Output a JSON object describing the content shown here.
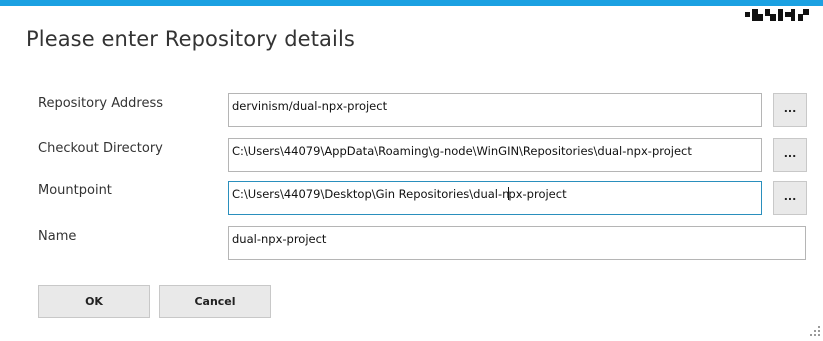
{
  "dialog": {
    "title": "Please enter Repository details"
  },
  "colors": {
    "accent": "#1ba1e2",
    "focus_border": "#2a8fbd",
    "button_bg": "#e9e9e9"
  },
  "fields": {
    "repository_address": {
      "label": "Repository Address",
      "value": "dervinism/dual-npx-project",
      "browse_label": "..."
    },
    "checkout_directory": {
      "label": "Checkout Directory",
      "value": "C:\\Users\\44079\\AppData\\Roaming\\g-node\\WinGIN\\Repositories\\dual-npx-project",
      "browse_label": "..."
    },
    "mountpoint": {
      "label": "Mountpoint",
      "value_before_caret": "C:\\Users\\44079\\Desktop\\Gin Repositories\\dual-n",
      "value_after_caret": "px-project",
      "browse_label": "..."
    },
    "name": {
      "label": "Name",
      "value": "dual-npx-project"
    }
  },
  "buttons": {
    "ok_label": "OK",
    "cancel_label": "Cancel"
  },
  "icons": {
    "window_controls": "window-controls-icon",
    "resize_grip": "resize-grip-icon"
  }
}
